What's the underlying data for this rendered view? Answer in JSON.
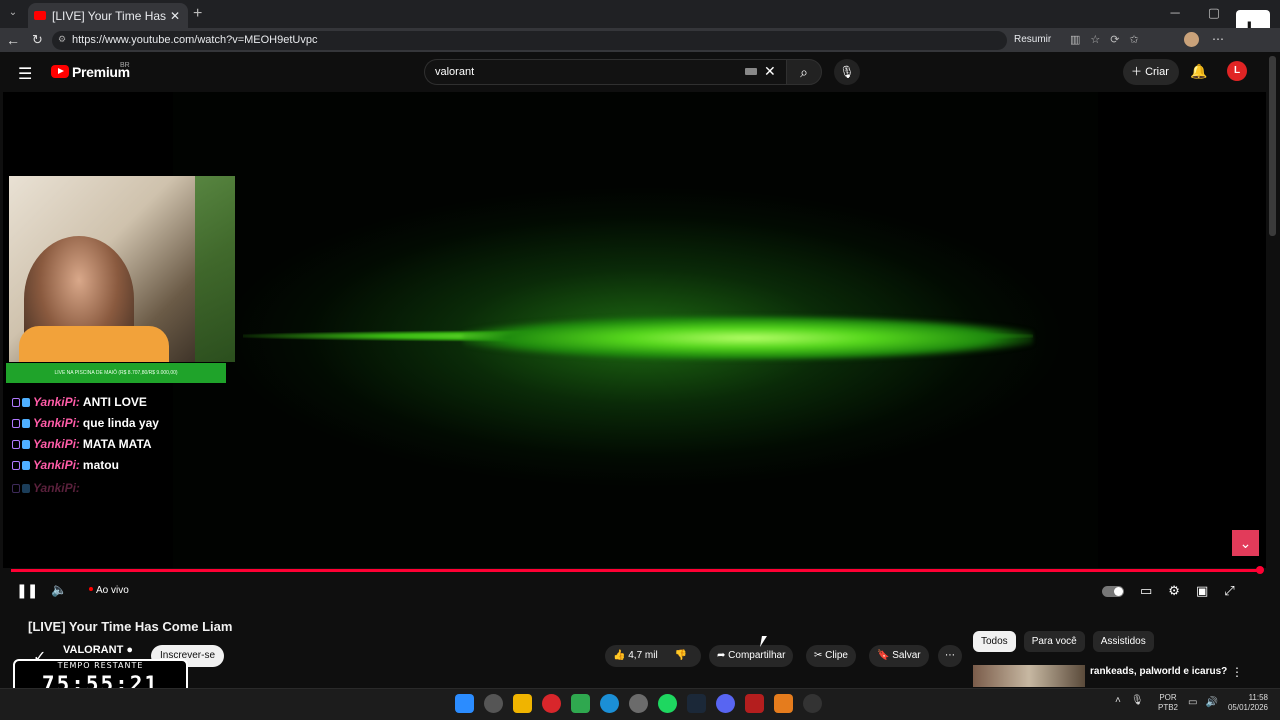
{
  "browser": {
    "tab_title": "[LIVE] Your Time Has Come Liam",
    "tab_close": "✕",
    "new_tab": "+",
    "url": "https://www.youtube.com/watch?v=MEOH9etUvpc",
    "resumir": "Resumir"
  },
  "youtube": {
    "brand": "Premium",
    "region": "BR",
    "search_value": "valorant",
    "create_label": "Criar",
    "avatar_letter": "L"
  },
  "overlay": {
    "goal_text": "LIVE NA PISCINA DE MAIÔ (R$ 8.707,80/R$ 9.000,00)",
    "chat": [
      {
        "user": "YankiPi:",
        "message": "ANTI LOVE"
      },
      {
        "user": "YankiPi:",
        "message": "que linda yay"
      },
      {
        "user": "YankiPi:",
        "message": "MATA MATA"
      },
      {
        "user": "YankiPi:",
        "message": "matou"
      },
      {
        "user": "YankiPi:",
        "message": ""
      }
    ],
    "timer_label": "TEMPO RESTANTE",
    "timer_value": "75:55:21"
  },
  "player": {
    "live_label": "Ao vivo",
    "progress": 1.0,
    "accent_color": "#ff0033"
  },
  "video_info": {
    "title": "[LIVE] Your Time Has Come Liam",
    "channel": "VALORANT",
    "subscribe_label": "Inscrever-se",
    "likes": "4,7 mil",
    "share_label": "Compartilhar",
    "clip_label": "Clipe",
    "save_label": "Salvar"
  },
  "recommendations": {
    "chips": [
      "Todos",
      "Para você",
      "Assistidos"
    ],
    "first_title": "rankeads, palworld e icarus?"
  },
  "taskbar": {
    "lang_top": "POR",
    "lang_bottom": "PTB2",
    "time": "11:58",
    "date": "05/01/2026"
  }
}
